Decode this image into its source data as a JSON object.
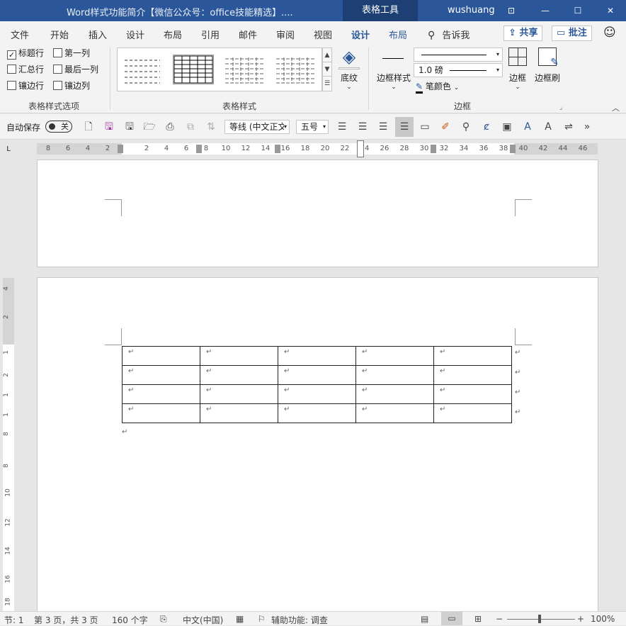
{
  "window": {
    "title": "Word样式功能简介【微信公众号：office技能精选】....",
    "context_tool": "表格工具",
    "user": "wushuang",
    "buttons": {
      "restore": "⊡",
      "minimize": "—",
      "maximize": "☐",
      "close": "✕"
    }
  },
  "tabs": [
    "文件",
    "开始",
    "插入",
    "设计",
    "布局",
    "引用",
    "邮件",
    "审阅",
    "视图",
    "设计",
    "布局"
  ],
  "active_tab_index": 9,
  "tell_me": "告诉我",
  "share_label": "共享",
  "comment_label": "批注",
  "ribbon": {
    "options_group": {
      "label": "表格样式选项",
      "checkboxes": [
        {
          "label": "标题行",
          "checked": true
        },
        {
          "label": "第一列",
          "checked": false
        },
        {
          "label": "汇总行",
          "checked": false
        },
        {
          "label": "最后一列",
          "checked": false
        },
        {
          "label": "镶边行",
          "checked": false
        },
        {
          "label": "镶边列",
          "checked": false
        }
      ]
    },
    "styles_group": {
      "label": "表格样式",
      "shading_label": "底纹"
    },
    "borders_group": {
      "label": "边框",
      "border_styles_label": "边框样式",
      "line_weight": "1.0 磅",
      "pen_color_label": "笔颜色",
      "borders_label": "边框",
      "border_painter_label": "边框刷"
    }
  },
  "qat": {
    "autosave_label": "自动保存",
    "autosave_state": "关",
    "font_name": "等线 (中文正文",
    "font_size": "五号"
  },
  "ruler": {
    "h_numbers": [
      "8",
      "6",
      "4",
      "2",
      "2",
      "4",
      "6",
      "8",
      "10",
      "12",
      "14",
      "16",
      "18",
      "20",
      "22",
      "24",
      "26",
      "28",
      "30",
      "32",
      "34",
      "36",
      "38",
      "40",
      "42",
      "44",
      "46"
    ],
    "v_numbers": [
      "4",
      "2",
      "1",
      "2",
      "1",
      "1",
      "8",
      "8",
      "10",
      "12",
      "14",
      "16",
      "18"
    ],
    "corner": "L"
  },
  "document": {
    "table_rows": 4,
    "table_cols": 5,
    "cell_mark": "↵",
    "paragraph_mark": "↵"
  },
  "statusbar": {
    "section": "节: 1",
    "page": "第 3 页，共 3 页",
    "words": "160 个字",
    "language": "中文(中国)",
    "accessibility": "辅助功能: 调查",
    "zoom": "100%"
  },
  "colors": {
    "accent": "#2b579a",
    "titlebar": "#2b579a",
    "context": "#1e3f74"
  }
}
